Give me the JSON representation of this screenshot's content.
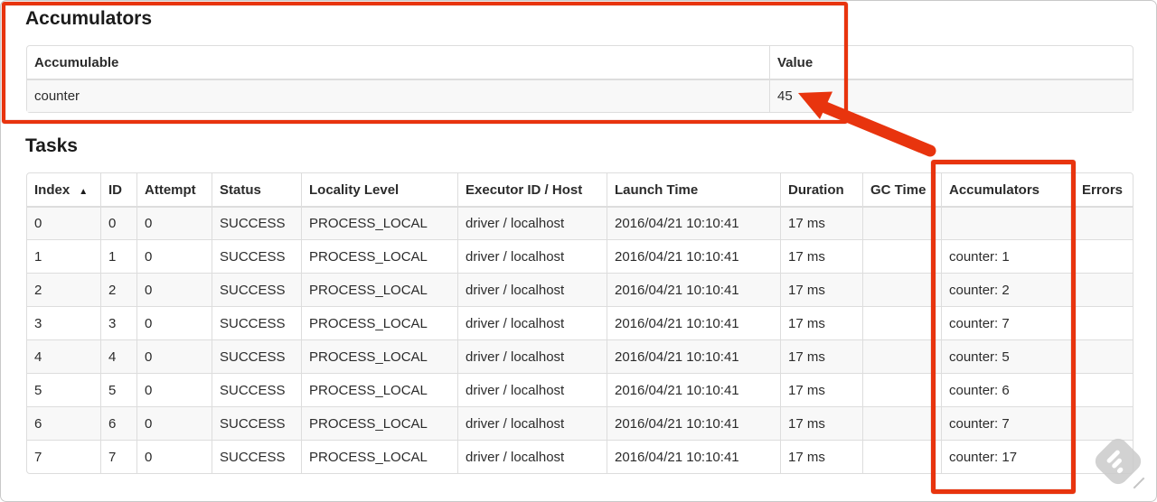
{
  "annotation": {
    "color": "#e8340e"
  },
  "accumulators_section": {
    "title": "Accumulators",
    "headers": {
      "accumulable": "Accumulable",
      "value": "Value"
    },
    "rows": [
      {
        "accumulable": "counter",
        "value": "45"
      }
    ]
  },
  "tasks_section": {
    "title": "Tasks",
    "sort_icon": "▲",
    "headers": {
      "index": "Index",
      "id": "ID",
      "attempt": "Attempt",
      "status": "Status",
      "locality": "Locality Level",
      "executor": "Executor ID / Host",
      "launch": "Launch Time",
      "duration": "Duration",
      "gc": "GC Time",
      "accumulators": "Accumulators",
      "errors": "Errors"
    },
    "rows": [
      {
        "index": "0",
        "id": "0",
        "attempt": "0",
        "status": "SUCCESS",
        "locality": "PROCESS_LOCAL",
        "executor": "driver / localhost",
        "launch": "2016/04/21 10:10:41",
        "duration": "17 ms",
        "gc": "",
        "accumulators": "",
        "errors": ""
      },
      {
        "index": "1",
        "id": "1",
        "attempt": "0",
        "status": "SUCCESS",
        "locality": "PROCESS_LOCAL",
        "executor": "driver / localhost",
        "launch": "2016/04/21 10:10:41",
        "duration": "17 ms",
        "gc": "",
        "accumulators": "counter: 1",
        "errors": ""
      },
      {
        "index": "2",
        "id": "2",
        "attempt": "0",
        "status": "SUCCESS",
        "locality": "PROCESS_LOCAL",
        "executor": "driver / localhost",
        "launch": "2016/04/21 10:10:41",
        "duration": "17 ms",
        "gc": "",
        "accumulators": "counter: 2",
        "errors": ""
      },
      {
        "index": "3",
        "id": "3",
        "attempt": "0",
        "status": "SUCCESS",
        "locality": "PROCESS_LOCAL",
        "executor": "driver / localhost",
        "launch": "2016/04/21 10:10:41",
        "duration": "17 ms",
        "gc": "",
        "accumulators": "counter: 7",
        "errors": ""
      },
      {
        "index": "4",
        "id": "4",
        "attempt": "0",
        "status": "SUCCESS",
        "locality": "PROCESS_LOCAL",
        "executor": "driver / localhost",
        "launch": "2016/04/21 10:10:41",
        "duration": "17 ms",
        "gc": "",
        "accumulators": "counter: 5",
        "errors": ""
      },
      {
        "index": "5",
        "id": "5",
        "attempt": "0",
        "status": "SUCCESS",
        "locality": "PROCESS_LOCAL",
        "executor": "driver / localhost",
        "launch": "2016/04/21 10:10:41",
        "duration": "17 ms",
        "gc": "",
        "accumulators": "counter: 6",
        "errors": ""
      },
      {
        "index": "6",
        "id": "6",
        "attempt": "0",
        "status": "SUCCESS",
        "locality": "PROCESS_LOCAL",
        "executor": "driver / localhost",
        "launch": "2016/04/21 10:10:41",
        "duration": "17 ms",
        "gc": "",
        "accumulators": "counter: 7",
        "errors": ""
      },
      {
        "index": "7",
        "id": "7",
        "attempt": "0",
        "status": "SUCCESS",
        "locality": "PROCESS_LOCAL",
        "executor": "driver / localhost",
        "launch": "2016/04/21 10:10:41",
        "duration": "17 ms",
        "gc": "",
        "accumulators": "counter: 17",
        "errors": ""
      }
    ]
  }
}
